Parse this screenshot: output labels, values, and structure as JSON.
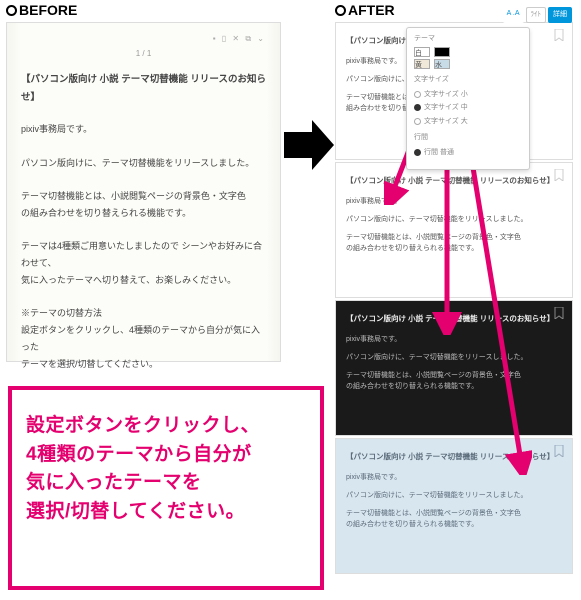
{
  "labels": {
    "before": "BEFORE",
    "after": "AFTER"
  },
  "before": {
    "page_indicator": "1 / 1",
    "title": "【パソコン版向け 小説 テーマ切替機能 リリースのお知らせ】",
    "p1": "pixiv事務局です。",
    "p2": "パソコン版向けに、テーマ切替機能をリリースしました。",
    "p3a": "テーマ切替機能とは、小説閲覧ページの背景色・文字色",
    "p3b": "の組み合わせを切り替えられる機能です。",
    "p4a": "テーマは4種類ご用意いたしましたので シーンやお好みに合わせて、",
    "p4b": "気に入ったテーマへ切り替えて、お楽しみください。",
    "p5a": "※テーマの切替方法",
    "p5b": "設定ボタンをクリックし、4種類のテーマから自分が気に入った",
    "p5c": "テーマを選択/切替してください。"
  },
  "popover": {
    "theme_label": "テーマ",
    "fontsize_label": "文字サイズ",
    "fs_s": "文字サイズ 小",
    "fs_m": "文字サイズ 中",
    "fs_l": "文字サイズ 大",
    "linesp_label": "行間",
    "ls_n": "行間 普通",
    "btn_aa": "A .A",
    "btn_light": "ﾗｲﾄ",
    "btn_primary": "詳細"
  },
  "after_title": "【パソコン版向け 小説 テーマ切替機能 リリースのお知らせ】",
  "after_p1": "pixiv事務局です。",
  "after_p2": "パソコン版向けに、テーマ切替機能をリリースしました。",
  "after_p3": "テーマ切替機能とは、小説閲覧ページの背景色・文字色",
  "after_p3b": "の組み合わせを切り替えられる機能です。",
  "after1_title": "【パソコン版向け 小説 テーマ切替｜ ( ) らせ】",
  "after1_p3": "テーマ切替機能とは、小説閲覧ページの",
  "after1_p3b": "組み合わせを切り替えられる機能で",
  "instruction": {
    "l1": "設定ボタンをクリックし、",
    "l2": "4種類のテーマから自分が",
    "l3": "気に入ったテーマを",
    "l4": "選択/切替してください。"
  }
}
